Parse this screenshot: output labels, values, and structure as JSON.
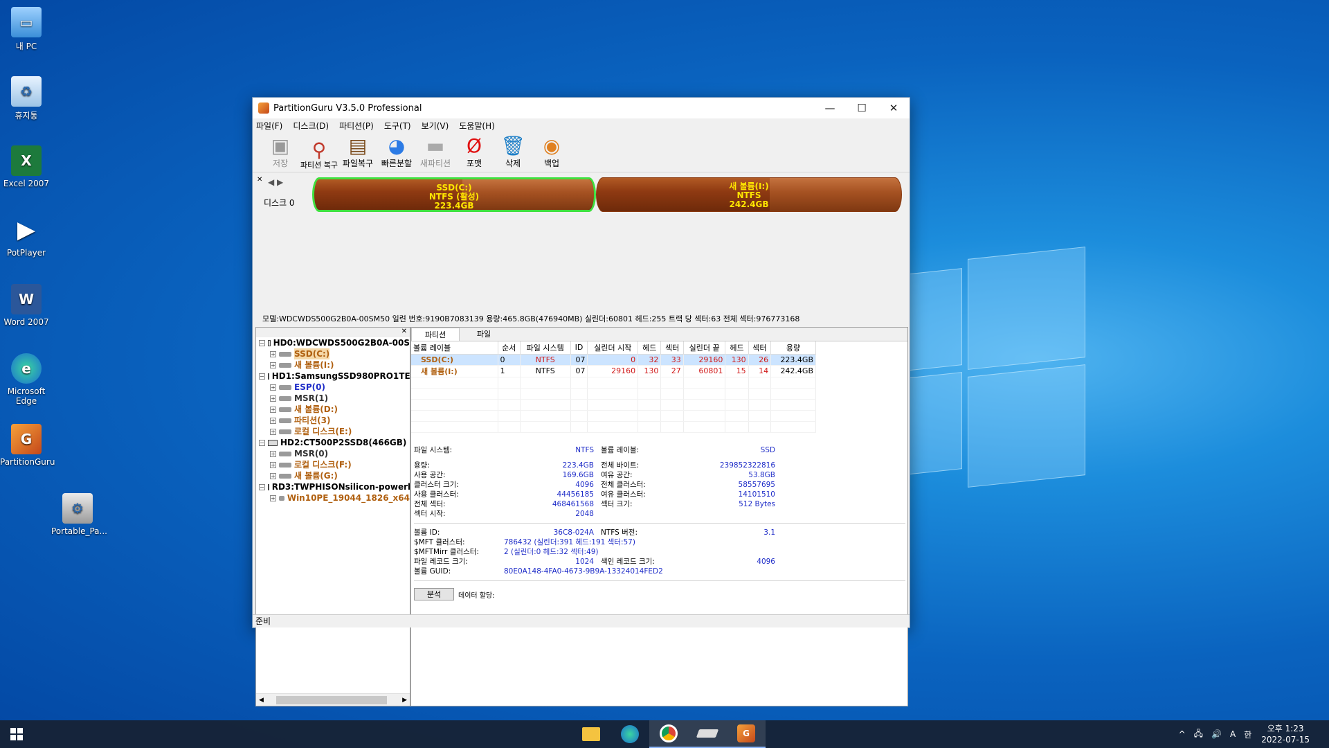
{
  "desktop": {
    "icons": [
      {
        "label": "내 PC"
      },
      {
        "label": "휴지통"
      },
      {
        "label": "Excel 2007"
      },
      {
        "label": "PotPlayer"
      },
      {
        "label": "Word 2007"
      },
      {
        "label": "Microsoft Edge"
      },
      {
        "label": "PartitionGuru"
      },
      {
        "label": "Portable_Pa..."
      }
    ]
  },
  "window": {
    "title": "PartitionGuru V3.5.0 Professional",
    "controls": {
      "minimize": "—",
      "maximize": "☐",
      "close": "✕"
    },
    "menu": [
      "파일(F)",
      "디스크(D)",
      "파티션(P)",
      "도구(T)",
      "보기(V)",
      "도움말(H)"
    ],
    "toolbar": [
      {
        "label": "저장",
        "icon": "save-icon",
        "enabled": false
      },
      {
        "label": "파티션 복구",
        "icon": "search-icon",
        "enabled": true
      },
      {
        "label": "파일복구",
        "icon": "file-recovery-icon",
        "enabled": true
      },
      {
        "label": "빠른분할",
        "icon": "quick-partition-icon",
        "enabled": true
      },
      {
        "label": "새파티션",
        "icon": "new-partition-icon",
        "enabled": false
      },
      {
        "label": "포맷",
        "icon": "format-icon",
        "enabled": true
      },
      {
        "label": "삭제",
        "icon": "delete-icon",
        "enabled": true
      },
      {
        "label": "백업",
        "icon": "backup-icon",
        "enabled": true
      }
    ],
    "diskbar": {
      "disk_label": "디스크  0",
      "partitions": [
        {
          "line1": "SSD(C:)",
          "line2": "NTFS (활성)",
          "line3": "223.4GB"
        },
        {
          "line1": "새 볼륨(I:)",
          "line2": "NTFS",
          "line3": "242.4GB"
        }
      ],
      "info": "모델:WDCWDS500G2B0A-00SM50  일련 번호:9190B7083139  용량:465.8GB(476940MB)  실린더:60801  헤드:255  트랙 당 섹터:63  전체 섹터:976773168"
    },
    "tree": [
      {
        "type": "disk",
        "label": "HD0:WDCWDS500G2B0A-00S"
      },
      {
        "type": "part",
        "label": "SSD(C:)",
        "style": "sel"
      },
      {
        "type": "part",
        "label": "새 볼륨(I:)",
        "style": "brown"
      },
      {
        "type": "disk",
        "label": "HD1:SamsungSSD980PRO1TE"
      },
      {
        "type": "part",
        "label": "ESP(0)",
        "style": "blue"
      },
      {
        "type": "part",
        "label": "MSR(1)",
        "style": "gray"
      },
      {
        "type": "part",
        "label": "새 볼륨(D:)",
        "style": "brown"
      },
      {
        "type": "part",
        "label": "파티션(3)",
        "style": "brown"
      },
      {
        "type": "part",
        "label": "로컬 디스크(E:)",
        "style": "brown"
      },
      {
        "type": "disk",
        "label": "HD2:CT500P2SSD8(466GB)"
      },
      {
        "type": "part",
        "label": "MSR(0)",
        "style": "gray"
      },
      {
        "type": "part",
        "label": "로컬 디스크(F:)",
        "style": "brown"
      },
      {
        "type": "part",
        "label": "새 볼륨(G:)",
        "style": "brown"
      },
      {
        "type": "disk",
        "label": "RD3:TWPHISONsilicon-powerl"
      },
      {
        "type": "part",
        "label": "Win10PE_19044_1826_x64",
        "style": "brown"
      }
    ],
    "tabs": [
      "파티션",
      "파일"
    ],
    "table": {
      "headers": [
        "볼륨 레이블",
        "순서",
        "파일 시스템",
        "ID",
        "실린더 시작",
        "헤드",
        "섹터",
        "실린더 끝",
        "헤드",
        "섹터",
        "용량"
      ],
      "rows": [
        [
          "SSD(C:)",
          "0",
          "NTFS",
          "07",
          "0",
          "32",
          "33",
          "29160",
          "130",
          "26",
          "223.4GB"
        ],
        [
          "새 볼륨(I:)",
          "1",
          "NTFS",
          "07",
          "29160",
          "130",
          "27",
          "60801",
          "15",
          "14",
          "242.4GB"
        ]
      ]
    },
    "details": {
      "fs_label": "파일 시스템:",
      "fs": "NTFS",
      "vol_label_label": "볼륨 레이블:",
      "vol_label": "SSD",
      "rows": [
        [
          "용량:",
          "223.4GB",
          "전체 바이트:",
          "239852322816"
        ],
        [
          "사용 공간:",
          "169.6GB",
          "여유 공간:",
          "53.8GB"
        ],
        [
          "클러스터 크기:",
          "4096",
          "전체 클러스터:",
          "58557695"
        ],
        [
          "사용 클러스터:",
          "44456185",
          "여유 클러스터:",
          "14101510"
        ],
        [
          "전체 섹터:",
          "468461568",
          "섹터 크기:",
          "512 Bytes"
        ],
        [
          "섹터 시작:",
          "2048",
          "",
          ""
        ]
      ],
      "rows2": [
        [
          "볼륨 ID:",
          "36C8-024A",
          "NTFS 버전:",
          "3.1"
        ],
        [
          "$MFT 클러스터:",
          "786432 (실린더:391 헤드:191 섹터:57)",
          "",
          ""
        ],
        [
          "$MFTMirr 클러스터:",
          "2 (실린더:0 헤드:32 섹터:49)",
          "",
          ""
        ],
        [
          "파일 레코드 크기:",
          "1024",
          "색인 레코드 크기:",
          "4096"
        ],
        [
          "볼륨 GUID:",
          "80E0A148-4FA0-4673-9B9A-13324014FED2",
          "",
          ""
        ]
      ],
      "analyze_btn": "분석",
      "data_alloc": "데이터 할당:"
    },
    "status": "준비"
  },
  "taskbar": {
    "apps": [
      "file-explorer-icon",
      "edge-icon",
      "chrome-icon",
      "drive-icon",
      "partitionguru-icon"
    ],
    "tray": {
      "chevron": "^",
      "ime": "A",
      "lang": "한",
      "time": "오후 1:23",
      "date": "2022-07-15"
    }
  },
  "colors": {
    "accent": "#0a63bf",
    "selected_row": "#cce4ff",
    "partition_active_border": "#3fe03f",
    "partition_text": "#ffe600"
  }
}
